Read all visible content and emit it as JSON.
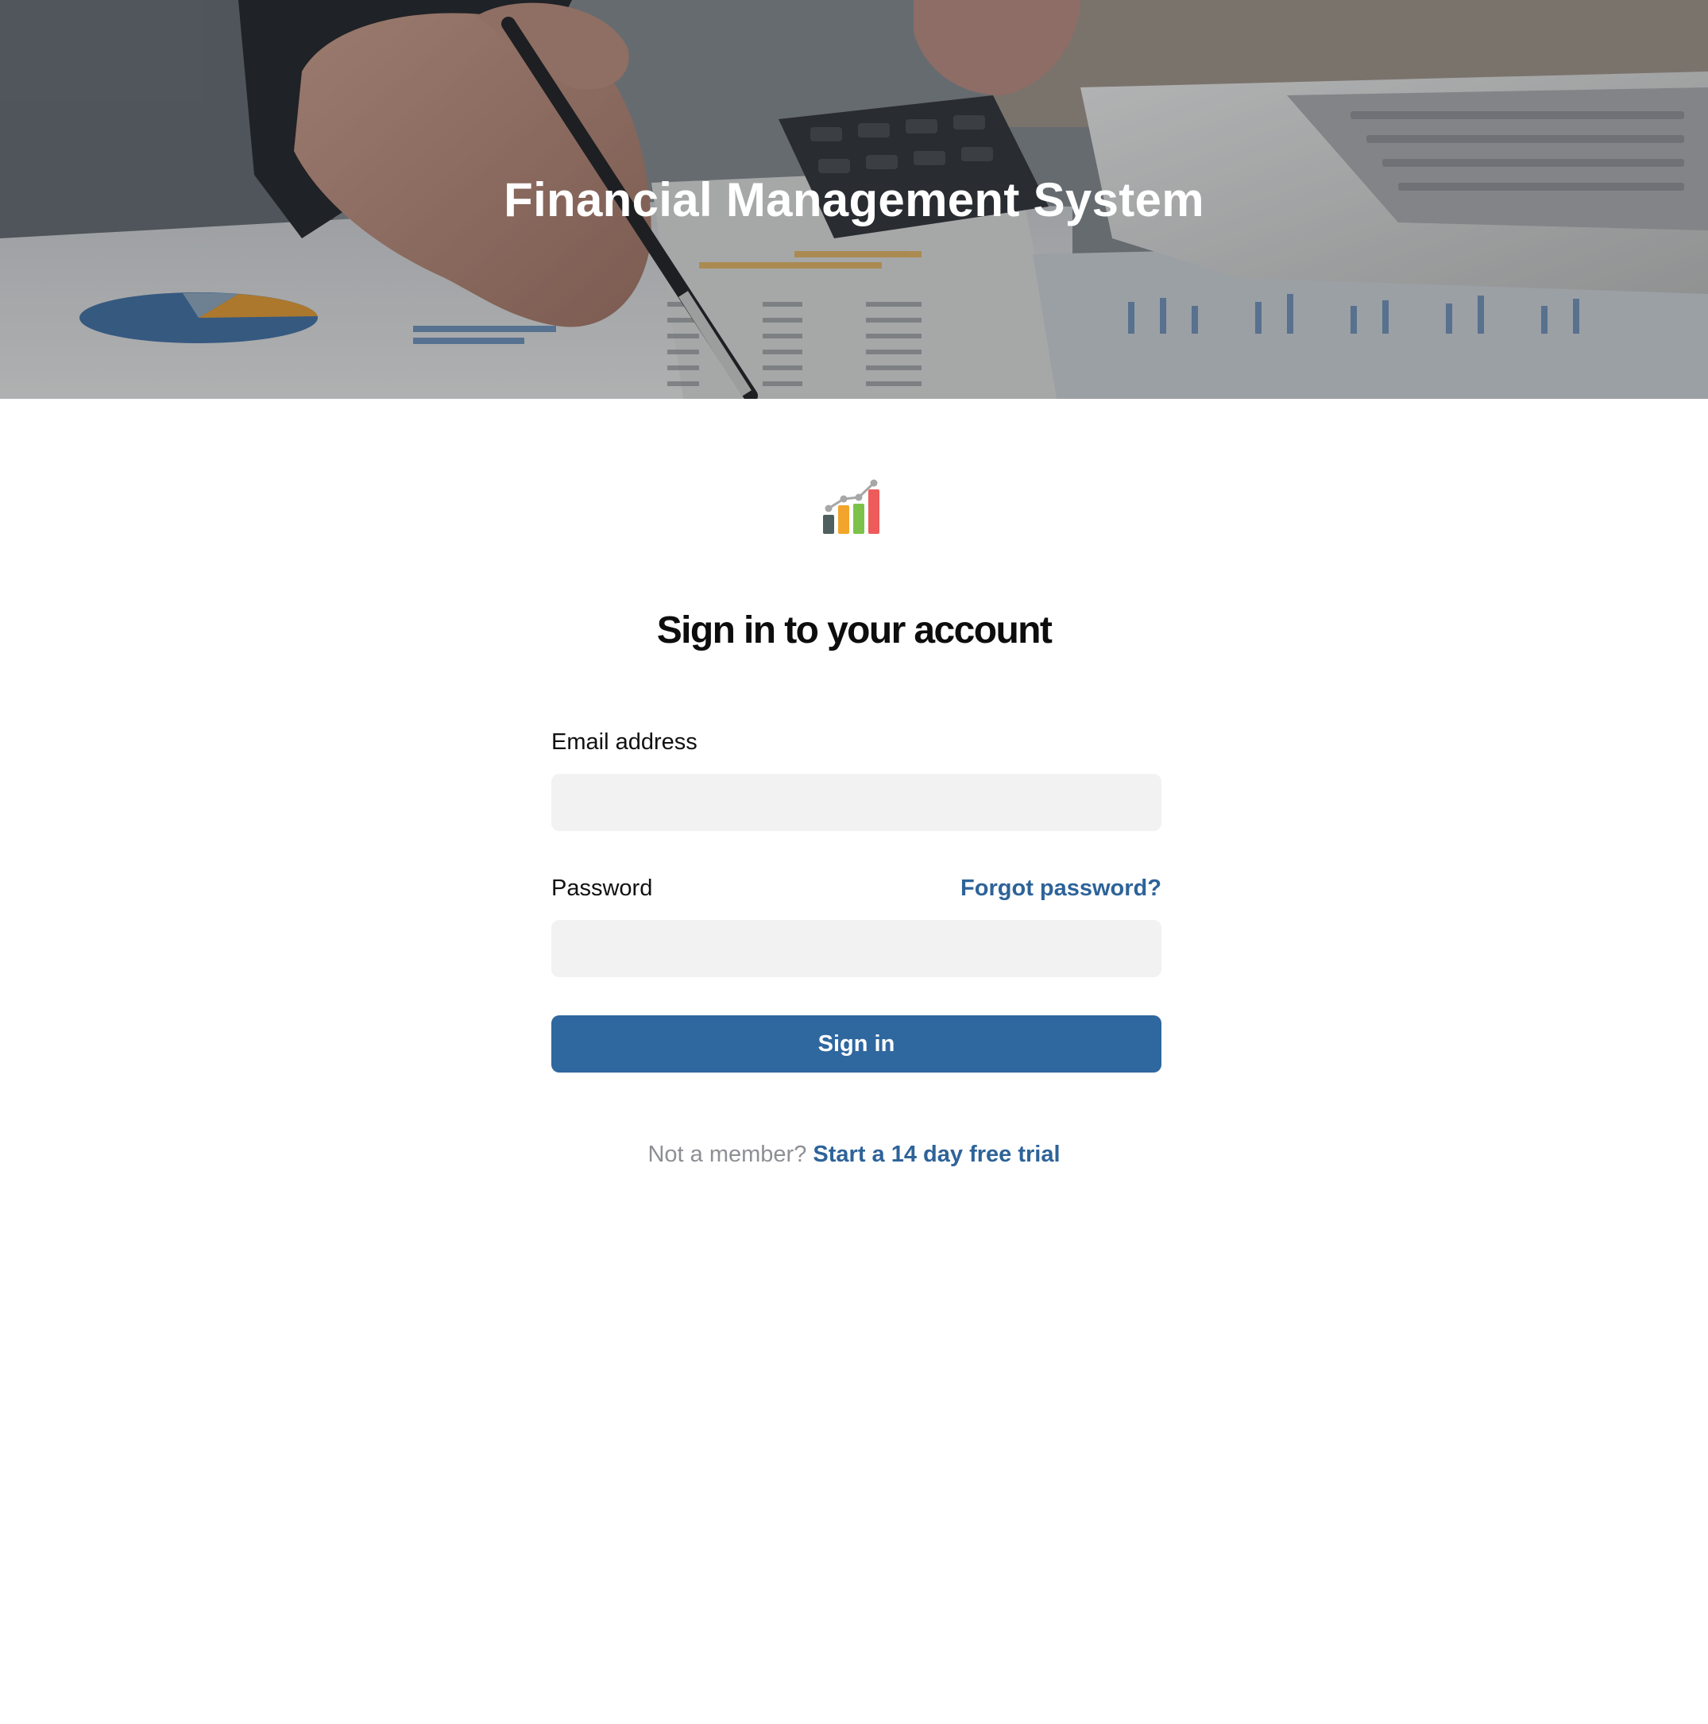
{
  "hero": {
    "title": "Financial Management System"
  },
  "logo": {
    "icon": "bar-chart-growth-icon",
    "colors": [
      "#4f5f5f",
      "#f2a52a",
      "#7cc24a",
      "#ee5b5b"
    ]
  },
  "login": {
    "heading": "Sign in to your account",
    "email_label": "Email address",
    "email_value": "",
    "password_label": "Password",
    "password_value": "",
    "forgot_label": "Forgot password?",
    "submit_label": "Sign in",
    "signup_prompt": "Not a member?",
    "signup_link": "Start a 14 day free trial"
  },
  "colors": {
    "accent": "#2f679f",
    "link": "#2e6399",
    "input_bg": "#f2f2f2",
    "muted_text": "#8d8f94"
  }
}
